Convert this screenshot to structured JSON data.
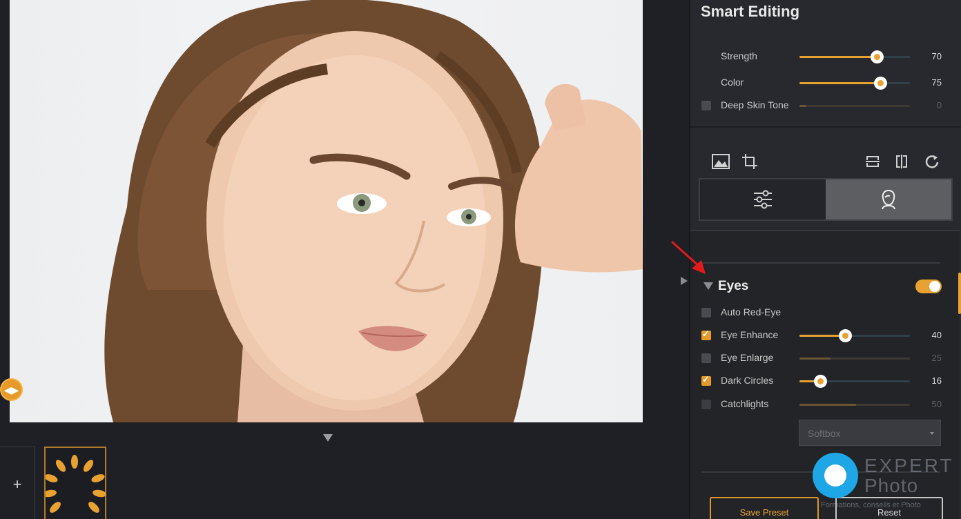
{
  "panel": {
    "title": "Smart Editing"
  },
  "smart": {
    "strength": {
      "label": "Strength",
      "value": "70",
      "level": 70
    },
    "color": {
      "label": "Color",
      "value": "75",
      "level": 75
    },
    "deep_skin": {
      "label": "Deep Skin Tone",
      "value": "0",
      "level": 0,
      "checked": false
    }
  },
  "toolbar": {
    "icons": [
      "image-icon",
      "crop-icon",
      "flip-vertical-icon",
      "flip-horizontal-icon",
      "rotate-icon"
    ]
  },
  "tabs": {
    "left_icon": "sliders-icon",
    "right_icon": "face-portrait-icon",
    "active": "right"
  },
  "eyes": {
    "title": "Eyes",
    "enabled": true,
    "auto_red_eye": {
      "label": "Auto Red-Eye",
      "checked": false
    },
    "eye_enhance": {
      "label": "Eye Enhance",
      "value": "40",
      "level": 40,
      "checked": true
    },
    "eye_enlarge": {
      "label": "Eye Enlarge",
      "value": "25",
      "level": 25,
      "checked": false
    },
    "dark_circles": {
      "label": "Dark Circles",
      "value": "16",
      "level": 16,
      "checked": true
    },
    "catchlights": {
      "label": "Catchlights",
      "value": "50",
      "level": 50,
      "checked": false
    },
    "catchlight_type": "Softbox"
  },
  "buttons": {
    "save_preset": "Save Preset",
    "reset": "Reset"
  },
  "watermark": {
    "line1": "EXPERT",
    "line2": "Photo",
    "line3": "Formations, conseils et Photo"
  },
  "colors": {
    "accent": "#e8a232",
    "panel": "#28292e",
    "canvas": "#1f2025"
  }
}
